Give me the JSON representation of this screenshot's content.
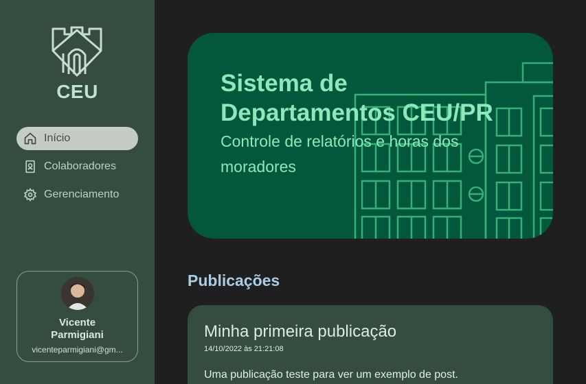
{
  "brand": {
    "name": "CEU"
  },
  "nav": {
    "items": [
      {
        "label": "Início",
        "icon": "home-icon",
        "active": true
      },
      {
        "label": "Colaboradores",
        "icon": "badge-icon",
        "active": false
      },
      {
        "label": "Gerenciamento",
        "icon": "gear-icon",
        "active": false
      }
    ]
  },
  "profile": {
    "name": "Vicente Parmigiani",
    "email": "vicenteparmigiani@gm..."
  },
  "hero": {
    "title": "Sistema de Departamentos CEU/PR",
    "subtitle": "Controle de relatórios e horas dos moradores"
  },
  "publications": {
    "heading": "Publicações",
    "posts": [
      {
        "title": "Minha primeira publicação",
        "date": "14/10/2022 às 21:21:08",
        "body": "Uma publicação teste para ver um exemplo de post."
      }
    ]
  },
  "colors": {
    "sidebar": "#354c40",
    "background": "#1f1f1f",
    "hero": "#03573a",
    "accent": "#8de8bb"
  }
}
